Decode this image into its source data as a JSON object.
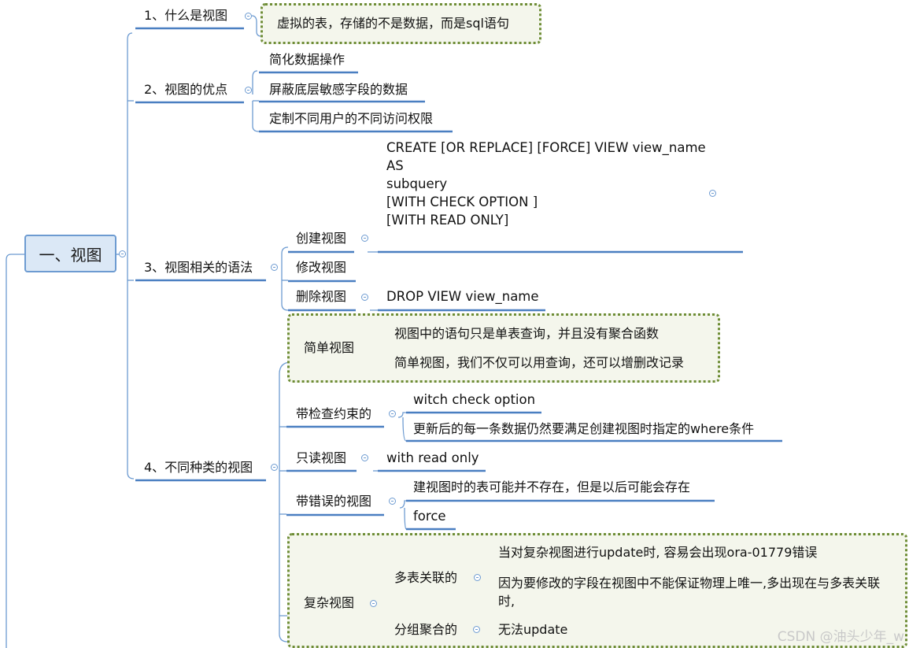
{
  "root": {
    "label": "一、视图"
  },
  "topics": {
    "t1": {
      "label": "1、什么是视图",
      "children": [
        "虚拟的表，存储的不是数据，而是sql语句"
      ]
    },
    "t2": {
      "label": "2、视图的优点",
      "children": [
        "简化数据操作",
        "屏蔽底层敏感字段的数据",
        "定制不同用户的不同访问权限"
      ]
    },
    "t3": {
      "label": "3、视图相关的语法",
      "create": {
        "label": "创建视图",
        "syntax": [
          "CREATE [OR REPLACE] [FORCE] VIEW view_name",
          "AS",
          "subquery",
          "[WITH CHECK OPTION ]",
          "[WITH READ ONLY]"
        ]
      },
      "modify": {
        "label": "修改视图"
      },
      "drop": {
        "label": "删除视图",
        "syntax": "DROP VIEW view_name"
      }
    },
    "t4": {
      "label": "4、不同种类的视图",
      "simple": {
        "label": "简单视图",
        "children": [
          "视图中的语句只是单表查询，并且没有聚合函数",
          "简单视图，我们不仅可以用查询，还可以增删改记录"
        ]
      },
      "check": {
        "label": "带检查约束的",
        "children": [
          "witch check option",
          "更新后的每一条数据仍然要满足创建视图时指定的where条件"
        ]
      },
      "readonly": {
        "label": "只读视图",
        "children": [
          "with read only"
        ]
      },
      "error": {
        "label": "带错误的视图",
        "children": [
          "建视图时的表可能并不存在，但是以后可能会存在",
          "force"
        ]
      },
      "complex": {
        "label": "复杂视图",
        "multi": {
          "label": "多表关联的",
          "children": [
            "当对复杂视图进行update时, 容易会出现ora-01779错误",
            "因为要修改的字段在视图中不能保证物理上唯一,多出现在与多表关联时,"
          ]
        },
        "group": {
          "label": "分组聚合的",
          "children": [
            "无法update"
          ]
        }
      }
    }
  },
  "watermark": "CSDN @油头少年_w",
  "colors": {
    "line": "#6d9bd1",
    "underline": "#4a7fc1",
    "dotted": "#6e8d36"
  }
}
